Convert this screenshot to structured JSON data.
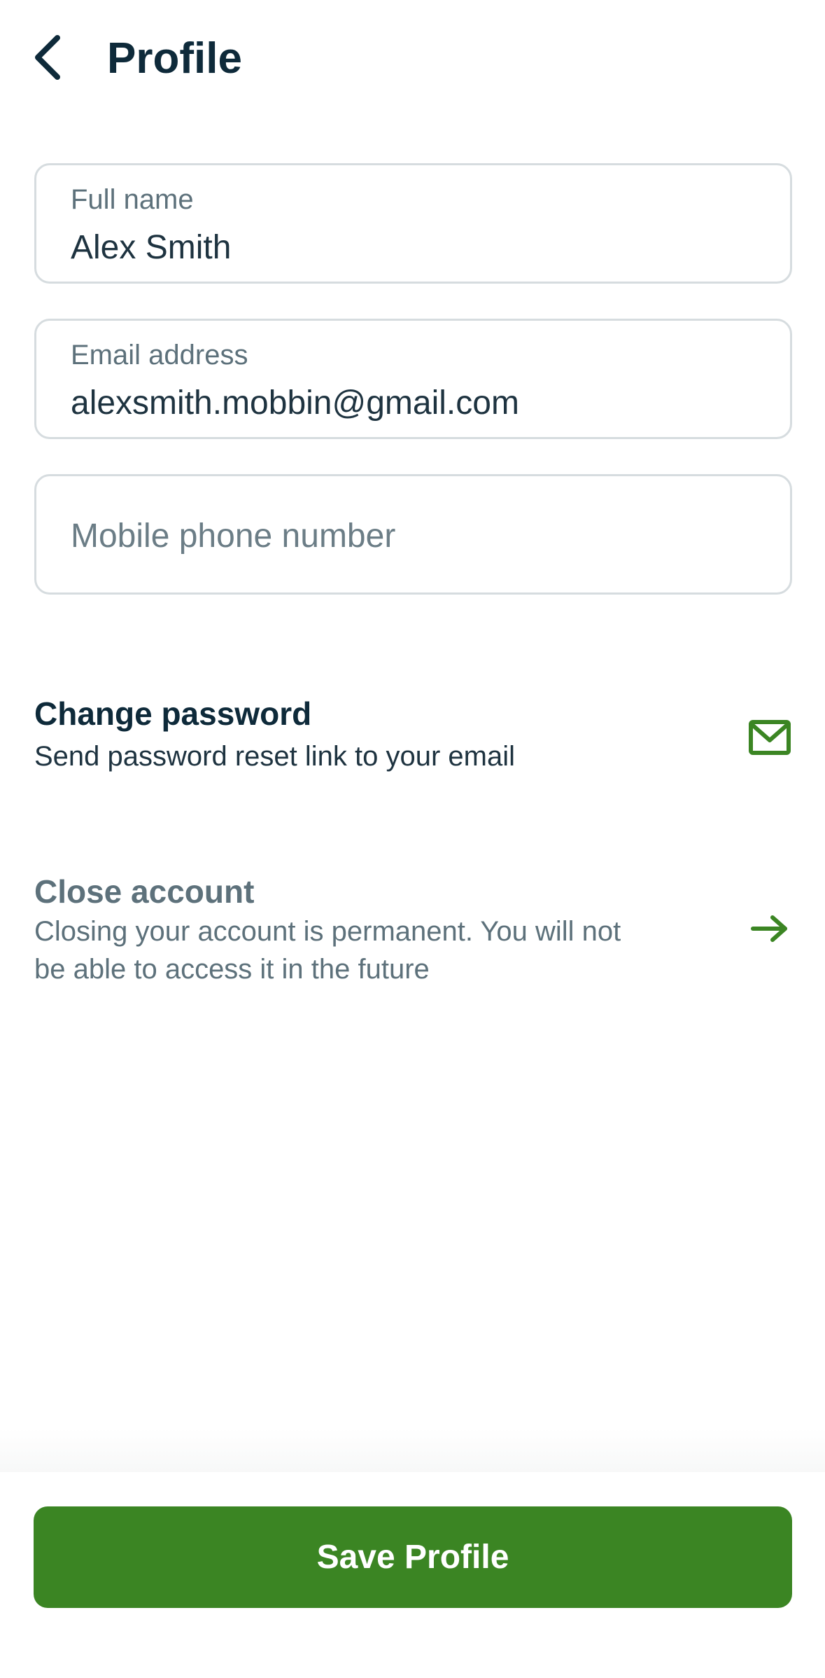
{
  "header": {
    "title": "Profile",
    "back_icon": "chevron-left-icon"
  },
  "form": {
    "full_name": {
      "label": "Full name",
      "value": "Alex Smith"
    },
    "email": {
      "label": "Email address",
      "value": "alexsmith.mobbin@gmail.com"
    },
    "phone": {
      "placeholder": "Mobile phone number",
      "value": ""
    }
  },
  "change_password": {
    "title": "Change password",
    "description": "Send password reset link to your email",
    "icon": "mail-icon"
  },
  "close_account": {
    "title": "Close account",
    "description_line1": "Closing your account is permanent. You will not",
    "description_line2": "be able to access it in the future",
    "icon": "arrow-right-icon"
  },
  "footer": {
    "save_label": "Save Profile"
  },
  "colors": {
    "primary": "#3b8523",
    "title_text": "#0e2a3a",
    "muted_text": "#5d717b",
    "border": "#d6dcdf"
  }
}
